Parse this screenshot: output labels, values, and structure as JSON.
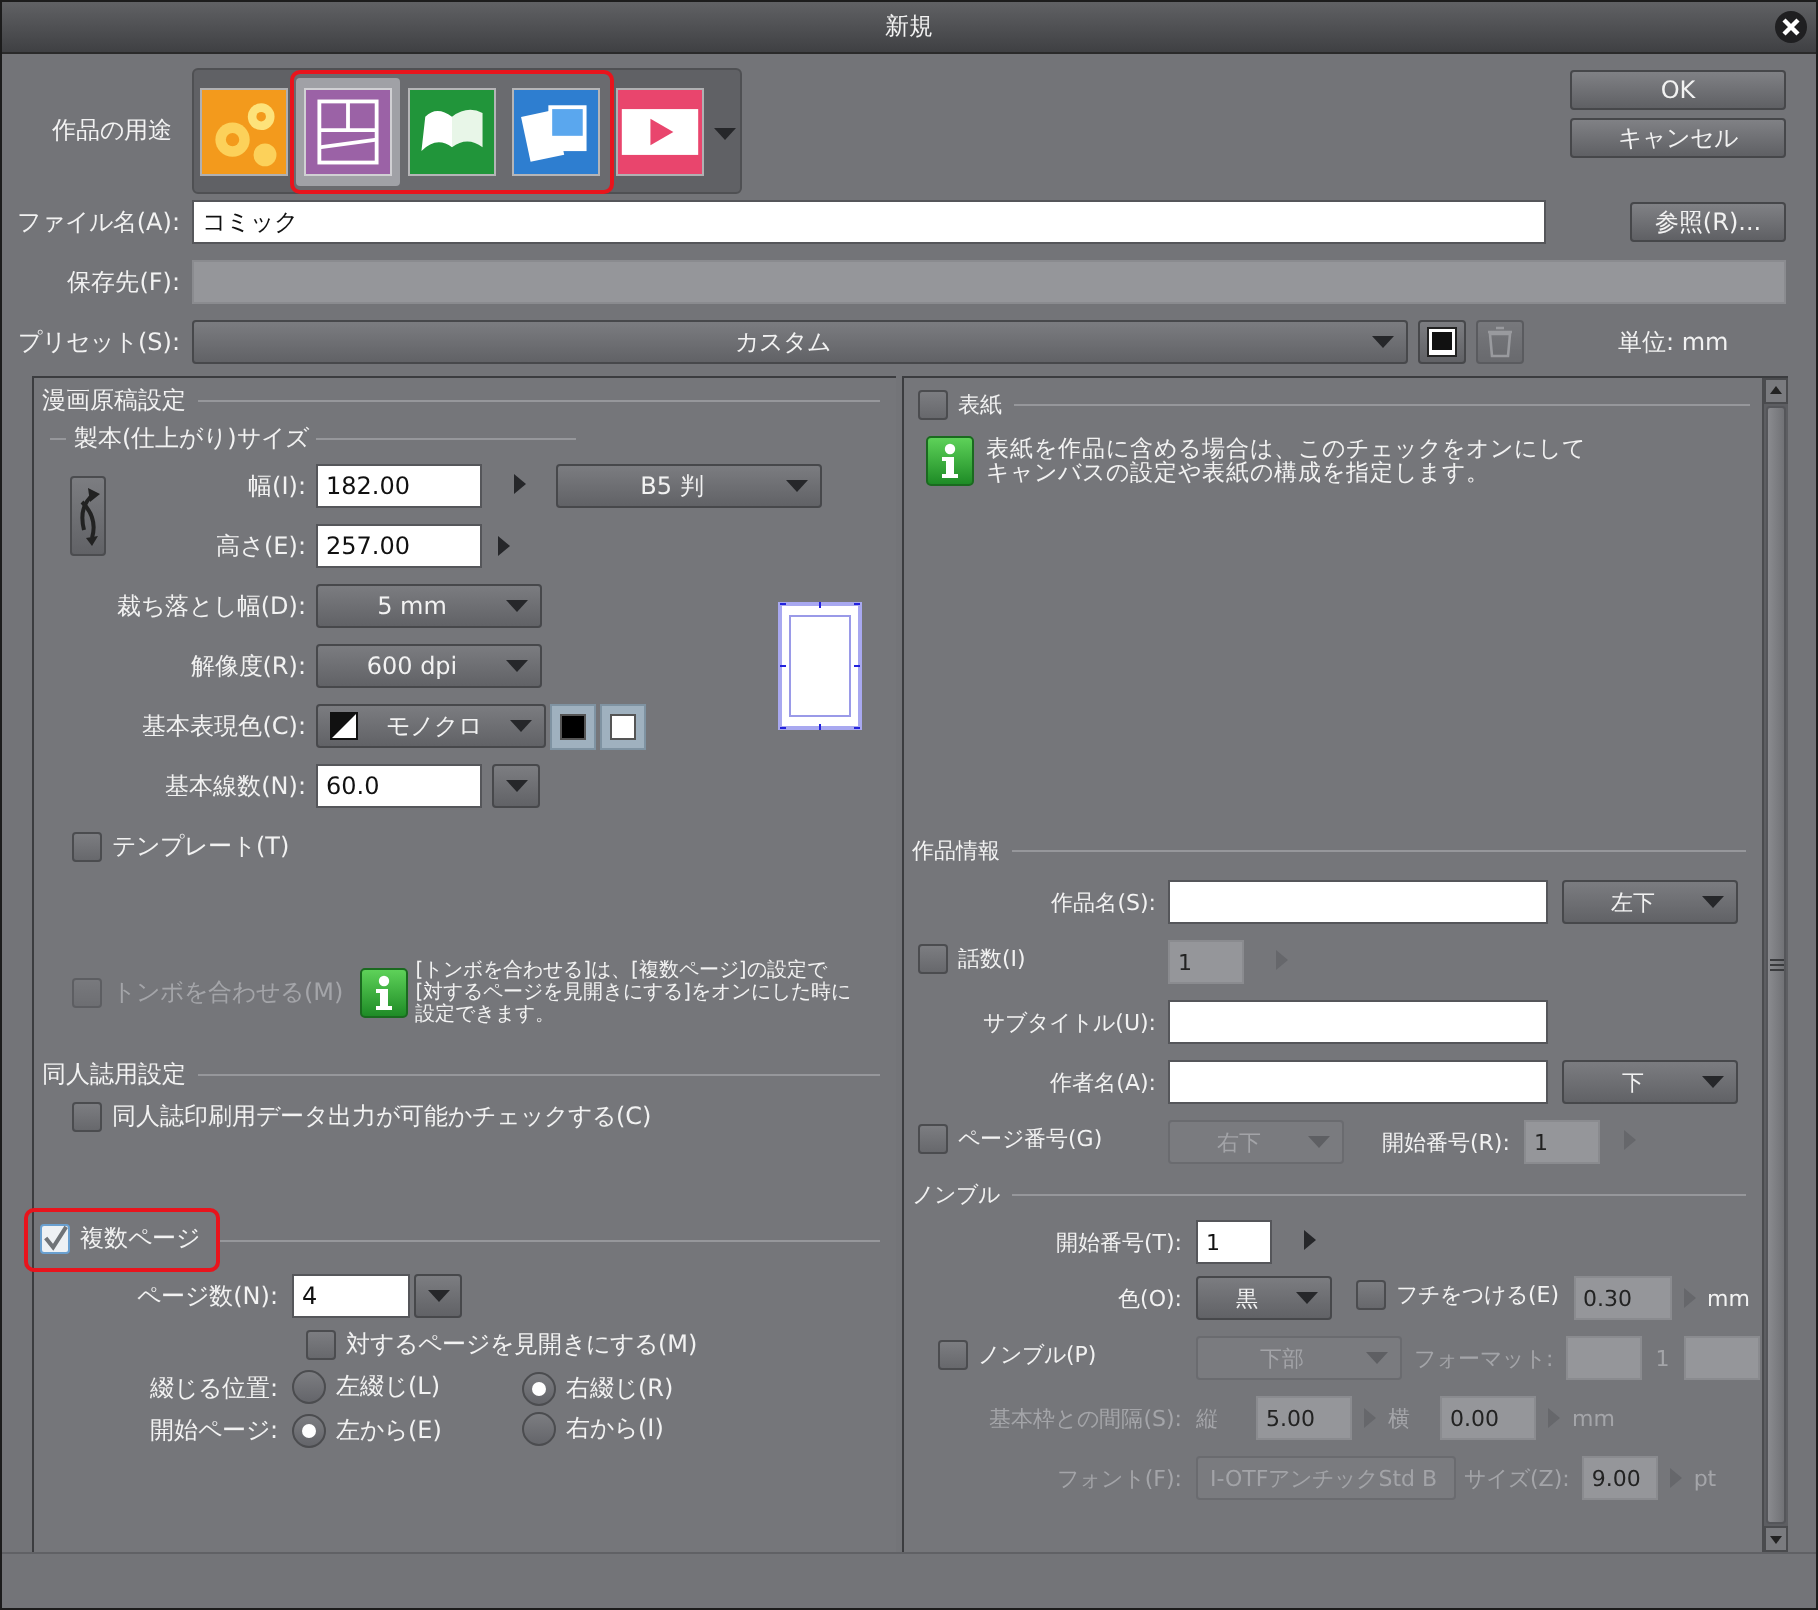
{
  "window": {
    "title": "新規"
  },
  "purpose": {
    "label": "作品の用途",
    "tiles": [
      {
        "kind": "illustration",
        "selected": false,
        "highlighted": false
      },
      {
        "kind": "comic",
        "selected": true,
        "highlighted": true
      },
      {
        "kind": "book",
        "selected": false,
        "highlighted": true
      },
      {
        "kind": "photo",
        "selected": false,
        "highlighted": true
      },
      {
        "kind": "animation",
        "selected": false,
        "highlighted": false
      }
    ]
  },
  "buttons": [
    {
      "label": "OK"
    },
    {
      "label": "キャンセル"
    }
  ],
  "file_name": {
    "label": "ファイル名(A):",
    "value": "コミック",
    "browse": "参照(R)..."
  },
  "save_location": {
    "label": "保存先(F):",
    "disabled": true
  },
  "preset": {
    "label": "プリセット(S):",
    "value": "カスタム",
    "unit": "単位: mm"
  },
  "manga_settings": {
    "title": "漫画原稿設定",
    "size_title": "製本(仕上がり)サイズ",
    "width": {
      "label": "幅(I):",
      "value": "182.00"
    },
    "height": {
      "label": "高さ(E):",
      "value": "257.00"
    },
    "size_preset": "B5 判",
    "bleed": {
      "label": "裁ち落とし幅(D):",
      "value": "5 mm"
    },
    "resolution": {
      "label": "解像度(R):",
      "value": "600 dpi"
    },
    "color_mode": {
      "label": "基本表現色(C):",
      "value": "モノクロ",
      "swatches": [
        {
          "color": "#000000"
        },
        {
          "color": "#ffffff"
        }
      ]
    },
    "line_count": {
      "label": "基本線数(N):",
      "value": "60.0"
    },
    "template": {
      "label": "テンプレート(T)",
      "checked": false
    },
    "crop_marks": {
      "label": "トンボを合わせる(M)",
      "checked": false,
      "disabled": true
    },
    "crop_note": [
      "[トンボを合わせる]は、[複数ページ]の設定で",
      "[対するページを見開きにする]をオンにした時に",
      "設定できます。"
    ]
  },
  "doujin": {
    "title": "同人誌用設定",
    "check": {
      "label": "同人誌印刷用データ出力が可能かチェックする(C)",
      "checked": false
    }
  },
  "multi_page": {
    "label": "複数ページ",
    "checked": true,
    "highlighted": true,
    "page_count": {
      "label": "ページ数(N):",
      "value": "4"
    },
    "spread": {
      "label": "対するページを見開きにする(M)",
      "checked": false
    },
    "binding": {
      "label": "綴じる位置:",
      "options": [
        {
          "label": "左綴じ(L)",
          "selected": false
        },
        {
          "label": "右綴じ(R)",
          "selected": true
        }
      ]
    },
    "start_page": {
      "label": "開始ページ:",
      "options": [
        {
          "label": "左から(E)",
          "selected": true
        },
        {
          "label": "右から(I)",
          "selected": false
        }
      ]
    }
  },
  "cover": {
    "label": "表紙",
    "checked": false,
    "note": [
      "表紙を作品に含める場合は、このチェックをオンにして",
      "キャンバスの設定や表紙の構成を指定します。"
    ]
  },
  "work_info": {
    "title": "作品情報",
    "title_field": {
      "label": "作品名(S):",
      "position": "左下"
    },
    "episode": {
      "label": "話数(I)",
      "checked": false,
      "value": "1"
    },
    "subtitle": {
      "label": "サブタイトル(U):"
    },
    "author": {
      "label": "作者名(A):",
      "position": "下"
    },
    "page_number": {
      "label": "ページ番号(G)",
      "checked": false,
      "position": "右下",
      "start_label": "開始番号(R):",
      "start_value": "1"
    }
  },
  "nombre": {
    "title": "ノンブル",
    "start": {
      "label": "開始番号(T):",
      "value": "1"
    },
    "color": {
      "label": "色(O):",
      "value": "黒"
    },
    "border": {
      "label": "フチをつける(E)",
      "checked": false,
      "value": "0.30",
      "unit": "mm"
    },
    "enable": {
      "label": "ノンブル(P)",
      "checked": false,
      "position": "下部",
      "format_label": "フォーマット:",
      "format_middle": "1"
    },
    "spacing": {
      "label": "基本枠との間隔(S):",
      "vertical_label": "縦",
      "vertical": "5.00",
      "horizontal_label": "横",
      "horizontal": "0.00",
      "unit": "mm"
    },
    "font": {
      "label": "フォント(F):",
      "value": "I-OTFアンチックStd B",
      "size_label": "サイズ(Z):",
      "size": "9.00",
      "unit": "pt"
    }
  }
}
